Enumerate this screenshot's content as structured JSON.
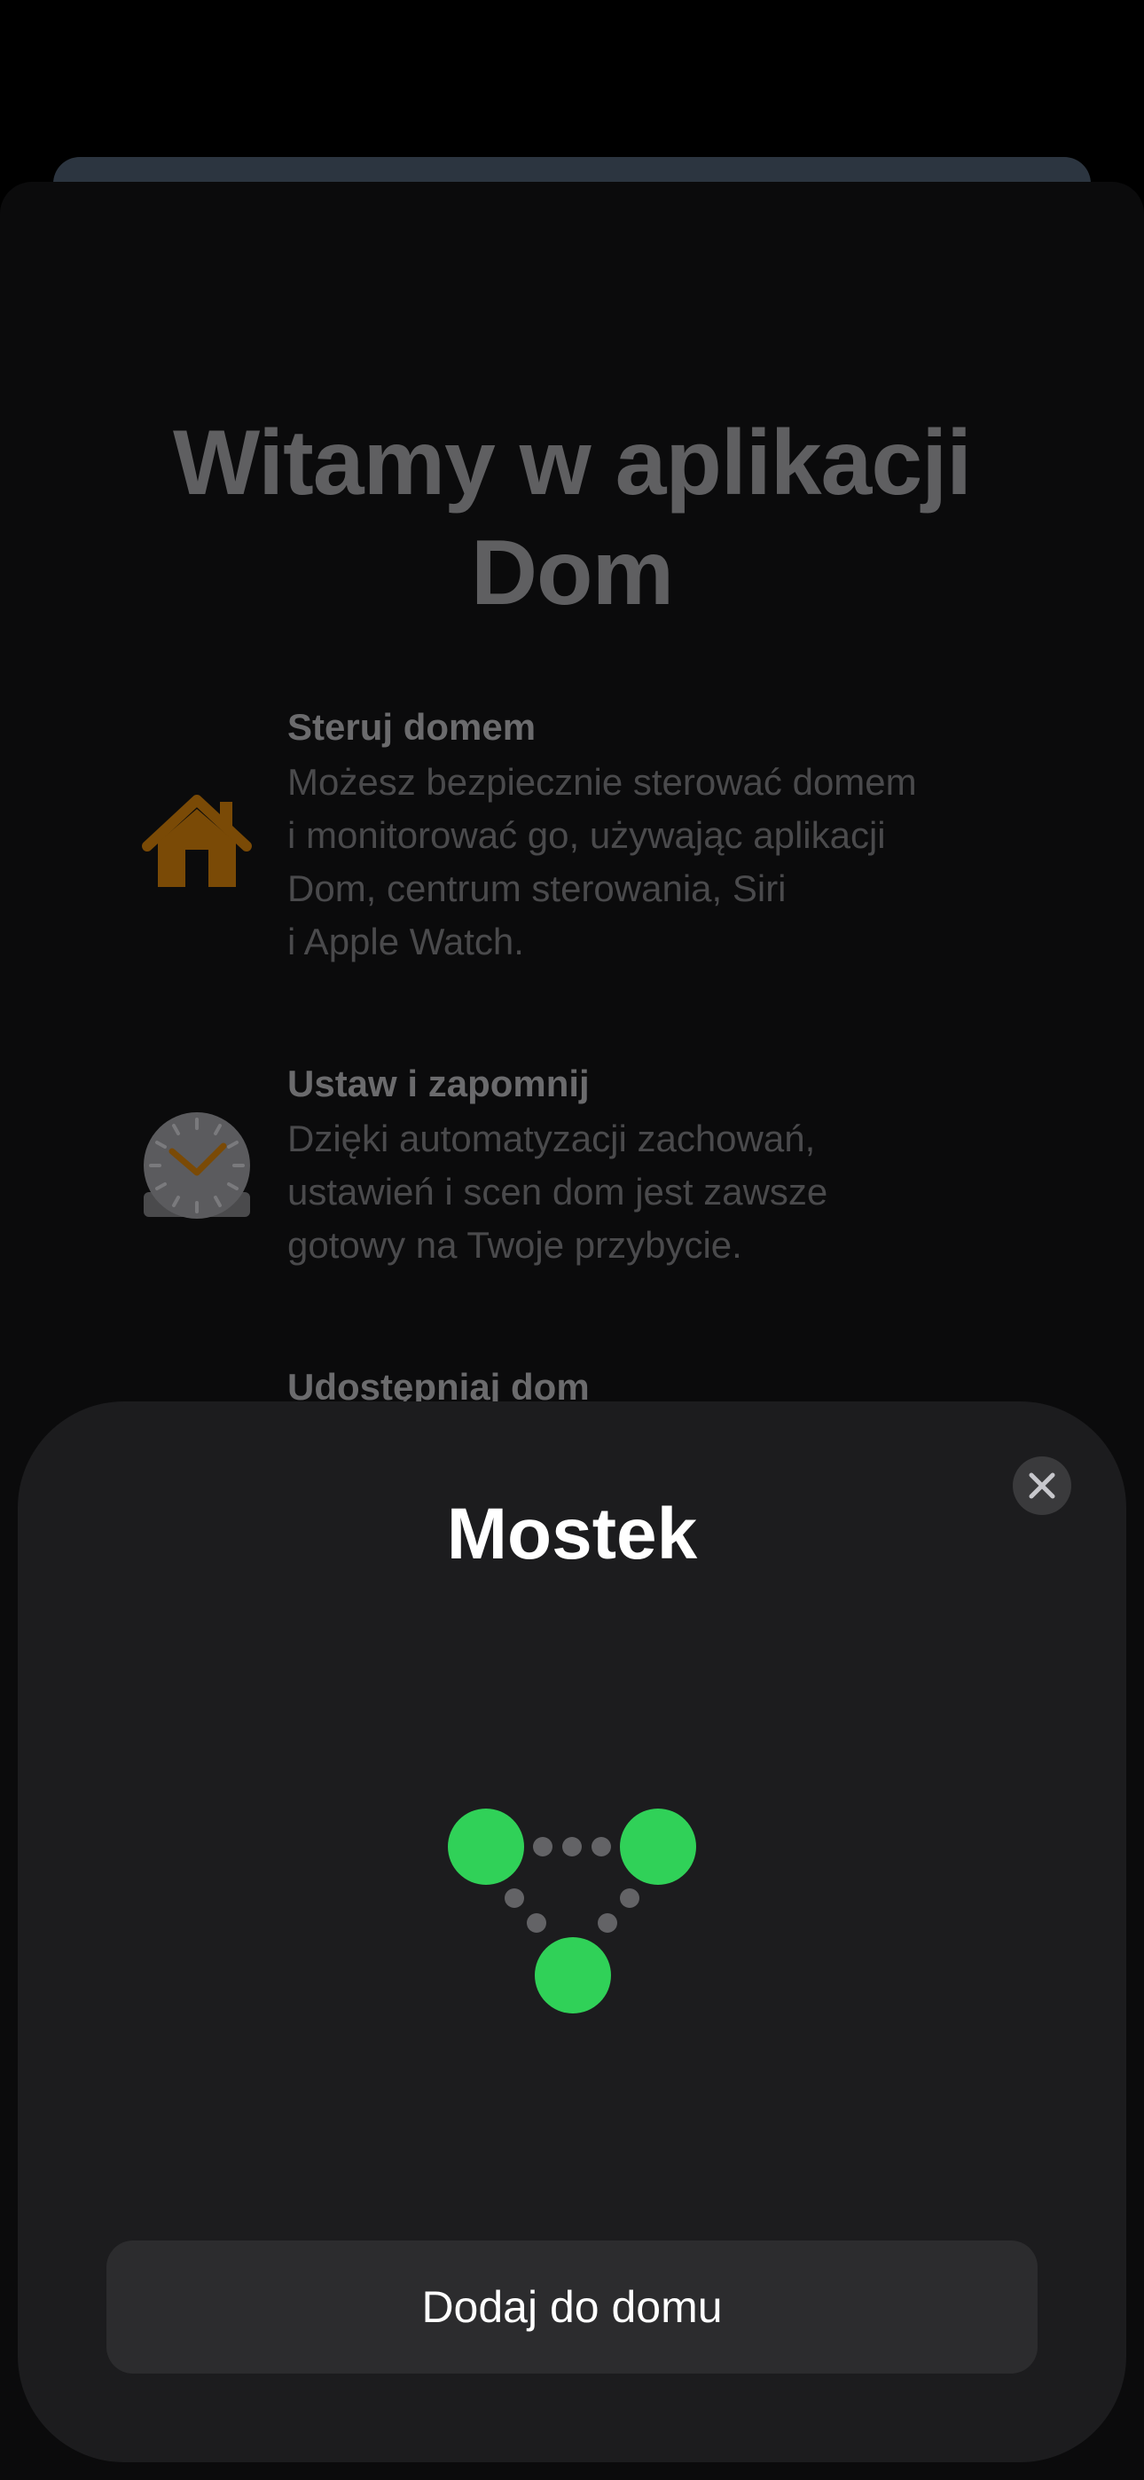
{
  "welcome": {
    "title": "Witamy w aplikacji Dom",
    "features": [
      {
        "icon": "house-icon",
        "heading": "Steruj domem",
        "text": "Możesz bezpiecznie sterować domem\ni monitorować go, używając aplikacji\nDom, centrum sterowania, Siri\ni Apple Watch."
      },
      {
        "icon": "clock-icon",
        "heading": "Ustaw i zapomnij",
        "text": "Dzięki automatyzacji zachowań,\nustawień i scen dom jest zawsze\ngotowy na Twoje przybycie."
      },
      {
        "icon": "",
        "heading": "Udostępniaj dom",
        "text": ""
      }
    ]
  },
  "card": {
    "title": "Mostek",
    "close_icon": "close-icon",
    "graphic_icon": "bridge-network-icon",
    "accent_color": "#30d158",
    "button_label": "Dodaj do domu"
  }
}
